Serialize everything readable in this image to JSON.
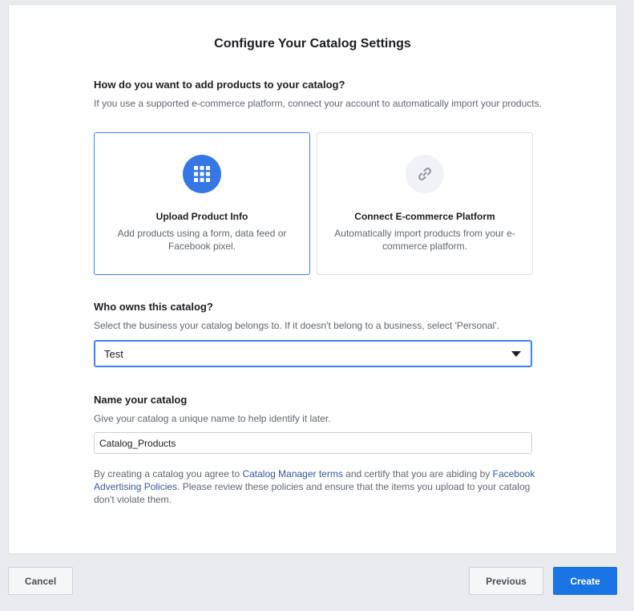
{
  "title": "Configure Your Catalog Settings",
  "add_products": {
    "heading": "How do you want to add products to your catalog?",
    "description": "If you use a supported e-commerce platform, connect your account to automatically import your products.",
    "options": [
      {
        "title": "Upload Product Info",
        "description": "Add products using a form, data feed or Facebook pixel.",
        "icon": "grid-icon",
        "selected": true
      },
      {
        "title": "Connect E-commerce Platform",
        "description": "Automatically import products from your e-commerce platform.",
        "icon": "link-icon",
        "selected": false
      }
    ]
  },
  "owner": {
    "heading": "Who owns this catalog?",
    "description": "Select the business your catalog belongs to. If it doesn't belong to a business, select 'Personal'.",
    "selected_value": "Test"
  },
  "name": {
    "heading": "Name your catalog",
    "description": "Give your catalog a unique name to help identify it later.",
    "value": "Catalog_Products"
  },
  "terms": {
    "part1": "By creating a catalog you agree to ",
    "link1": "Catalog Manager terms",
    "part2": " and certify that you are abiding by ",
    "link2": "Facebook Advertising Policies",
    "part3": ". Please review these policies and ensure that the items you upload to your catalog don't violate them."
  },
  "footer": {
    "cancel_label": "Cancel",
    "previous_label": "Previous",
    "create_label": "Create"
  },
  "colors": {
    "accent": "#1b74e4",
    "selected_border": "#4080ff",
    "icon_blue": "#3578e5",
    "link": "#385898"
  }
}
